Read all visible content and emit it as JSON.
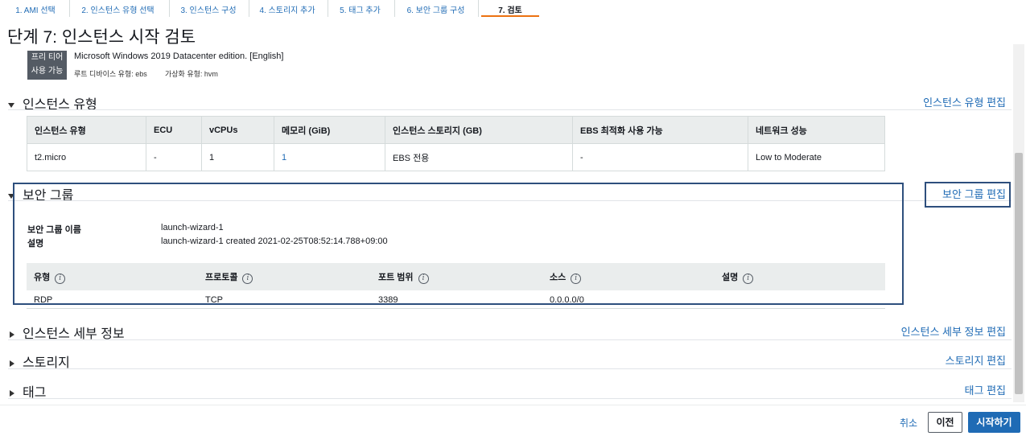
{
  "wizard": {
    "steps": [
      "1. AMI 선택",
      "2. 인스턴스 유형 선택",
      "3. 인스턴스 구성",
      "4. 스토리지 추가",
      "5. 태그 추가",
      "6. 보안 그룹 구성",
      "7. 검토"
    ]
  },
  "page": {
    "title": "단계 7: 인스턴스 시작 검토"
  },
  "ami": {
    "badge_line1": "프리 티어",
    "badge_line2": "사용 가능",
    "name": "Microsoft Windows 2019 Datacenter edition. [English]",
    "root_device": "루트 디바이스 유형: ebs",
    "virtualization": "가상화 유형: hvm"
  },
  "instance_type": {
    "heading": "인스턴스 유형",
    "edit_label": "인스턴스 유형 편집",
    "columns": [
      "인스턴스 유형",
      "ECU",
      "vCPUs",
      "메모리 (GiB)",
      "인스턴스 스토리지 (GB)",
      "EBS 최적화 사용 가능",
      "네트워크 성능"
    ],
    "row": [
      "t2.micro",
      "-",
      "1",
      "1",
      "EBS 전용",
      "-",
      "Low to Moderate"
    ]
  },
  "security_group": {
    "heading": "보안 그룹",
    "edit_label": "보안 그룹 편집",
    "name_label": "보안 그룹 이름",
    "name_value": "launch-wizard-1",
    "desc_label": "설명",
    "desc_value": "launch-wizard-1 created 2021-02-25T08:52:14.788+09:00",
    "rule_columns": [
      "유형",
      "프로토콜",
      "포트 범위",
      "소스",
      "설명"
    ],
    "info_glyph": "i",
    "rule_row": [
      "RDP",
      "TCP",
      "3389",
      "0.0.0.0/0",
      ""
    ]
  },
  "instance_details": {
    "heading": "인스턴스 세부 정보",
    "edit_label": "인스턴스 세부 정보 편집"
  },
  "storage": {
    "heading": "스토리지",
    "edit_label": "스토리지 편집"
  },
  "tags": {
    "heading": "태그",
    "edit_label": "태그 편집"
  },
  "footer": {
    "cancel": "취소",
    "previous": "이전",
    "launch": "시작하기"
  },
  "colors": {
    "link": "#1f6bb5",
    "active_step": "#ec7211",
    "highlight_box": "#2e4f7d",
    "primary_button": "#1f6bb5"
  }
}
